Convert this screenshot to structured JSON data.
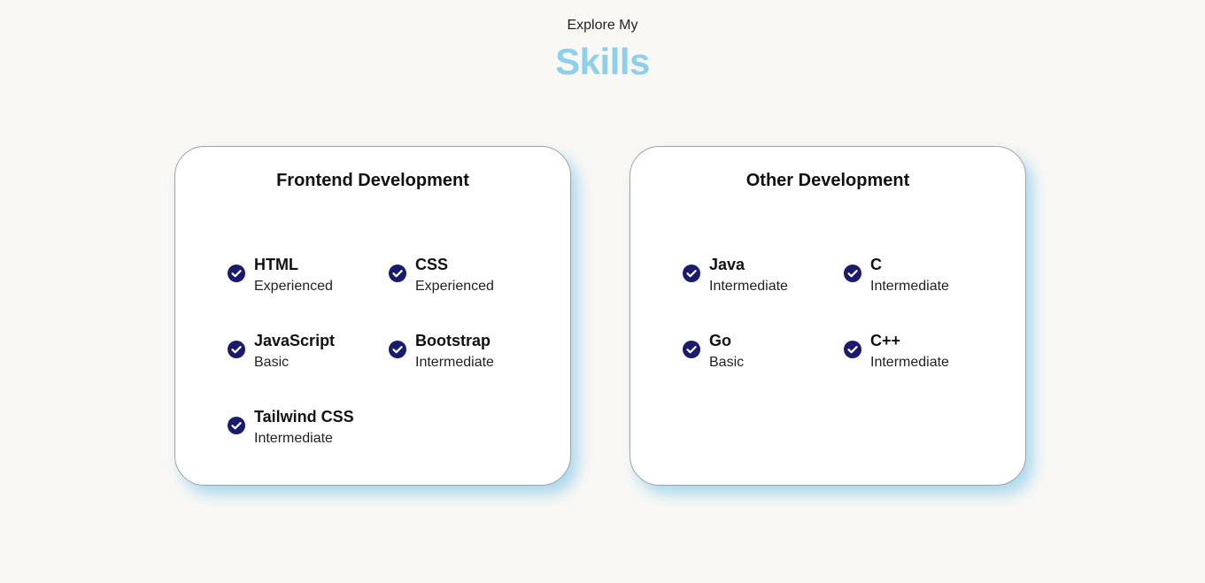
{
  "header": {
    "eyebrow": "Explore My",
    "title": "Skills"
  },
  "colors": {
    "accent": "#8ecfeb",
    "check_fill": "#1a1a6e",
    "background": "#f9f8f5",
    "card_shadow": "#6ebee6"
  },
  "cards": [
    {
      "title": "Frontend Development",
      "skills": [
        {
          "name": "HTML",
          "level": "Experienced",
          "icon": "check-circle-icon"
        },
        {
          "name": "CSS",
          "level": "Experienced",
          "icon": "check-circle-icon"
        },
        {
          "name": "JavaScript",
          "level": "Basic",
          "icon": "check-circle-icon"
        },
        {
          "name": "Bootstrap",
          "level": "Intermediate",
          "icon": "check-circle-icon"
        },
        {
          "name": "Tailwind CSS",
          "level": "Intermediate",
          "icon": "check-circle-icon"
        }
      ]
    },
    {
      "title": "Other Development",
      "skills": [
        {
          "name": "Java",
          "level": "Intermediate",
          "icon": "check-circle-icon"
        },
        {
          "name": "C",
          "level": "Intermediate",
          "icon": "check-circle-icon"
        },
        {
          "name": "Go",
          "level": "Basic",
          "icon": "check-circle-icon"
        },
        {
          "name": "C++",
          "level": "Intermediate",
          "icon": "check-circle-icon"
        }
      ]
    }
  ]
}
